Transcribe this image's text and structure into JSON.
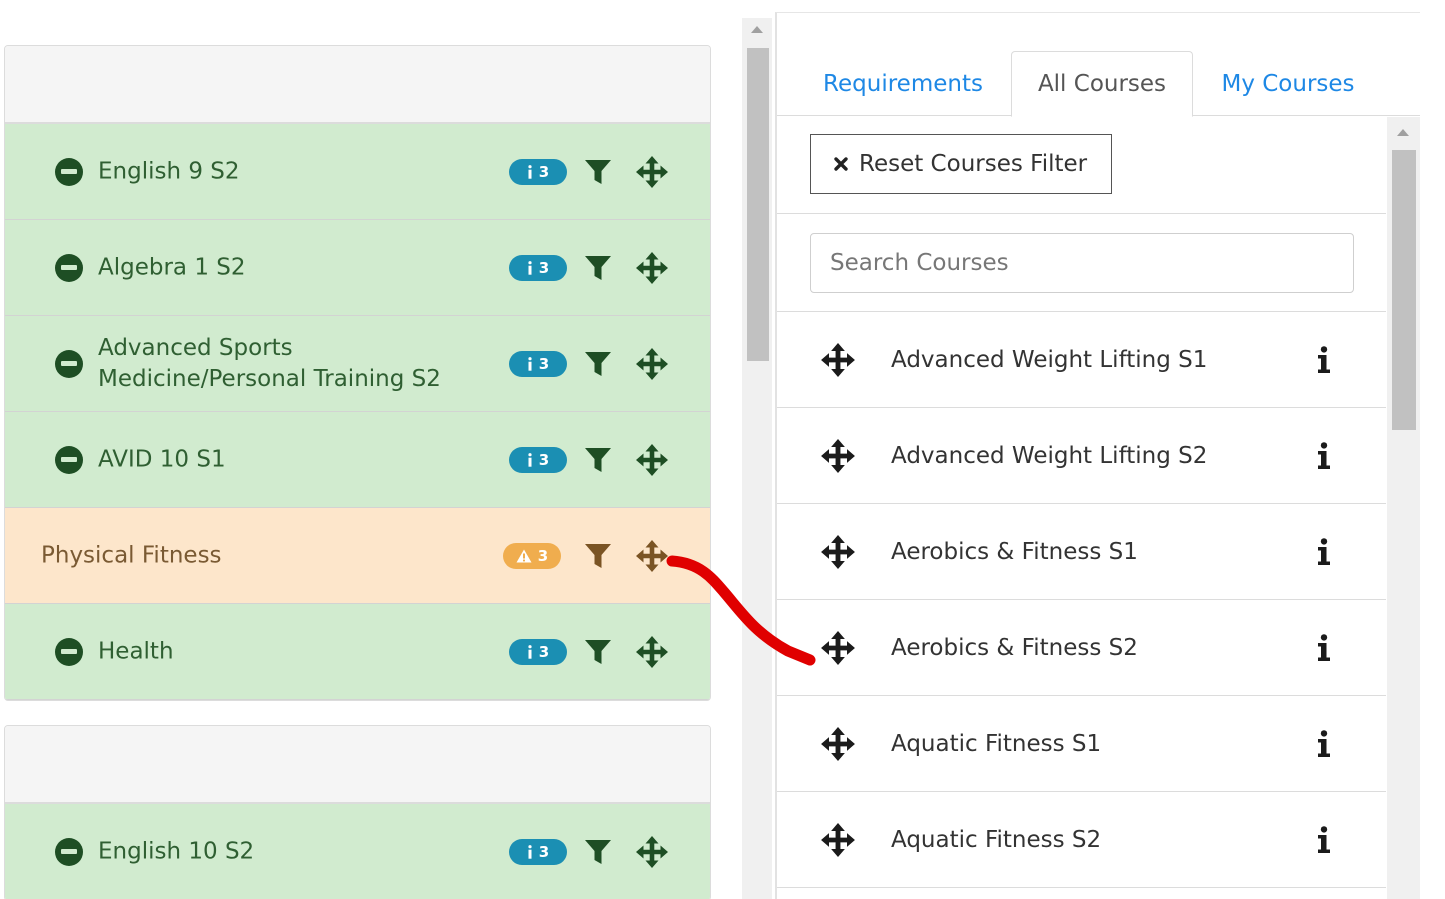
{
  "colors": {
    "ok_row": "#d1ebcf",
    "warn_row": "#fde6cb",
    "ok_icon": "#1e4e24",
    "warn_icon": "#7a5424",
    "info_badge": "#1b8fb3",
    "warn_badge": "#f0ad4e",
    "tab_link": "#1e88e5",
    "annotation_stroke": "#e00000"
  },
  "plan": {
    "cards": [
      {
        "rows": [
          {
            "type": "ok",
            "name": "English 9 S2",
            "badge": "3",
            "badge_icon": "info-icon"
          },
          {
            "type": "ok",
            "name": "Algebra 1 S2",
            "badge": "3",
            "badge_icon": "info-icon"
          },
          {
            "type": "ok",
            "name": "Advanced Sports Medicine/Personal Training S2",
            "badge": "3",
            "badge_icon": "info-icon"
          },
          {
            "type": "ok",
            "name": "AVID 10 S1",
            "badge": "3",
            "badge_icon": "info-icon"
          },
          {
            "type": "warn",
            "name": "Physical Fitness",
            "badge": "3",
            "badge_icon": "warning-icon"
          },
          {
            "type": "ok",
            "name": "Health",
            "badge": "3",
            "badge_icon": "info-icon"
          }
        ]
      },
      {
        "rows": [
          {
            "type": "ok",
            "name": "English 10 S2",
            "badge": "3",
            "badge_icon": "info-icon"
          }
        ]
      }
    ]
  },
  "sidebar": {
    "tabs": [
      {
        "label": "Requirements",
        "active": false
      },
      {
        "label": "All Courses",
        "active": true
      },
      {
        "label": "My Courses",
        "active": false
      }
    ],
    "reset_label": "Reset Courses Filter",
    "search_placeholder": "Search Courses",
    "courses": [
      "Advanced Weight Lifting S1",
      "Advanced Weight Lifting S2",
      "Aerobics & Fitness S1",
      "Aerobics & Fitness S2",
      "Aquatic Fitness S1",
      "Aquatic Fitness S2"
    ]
  }
}
